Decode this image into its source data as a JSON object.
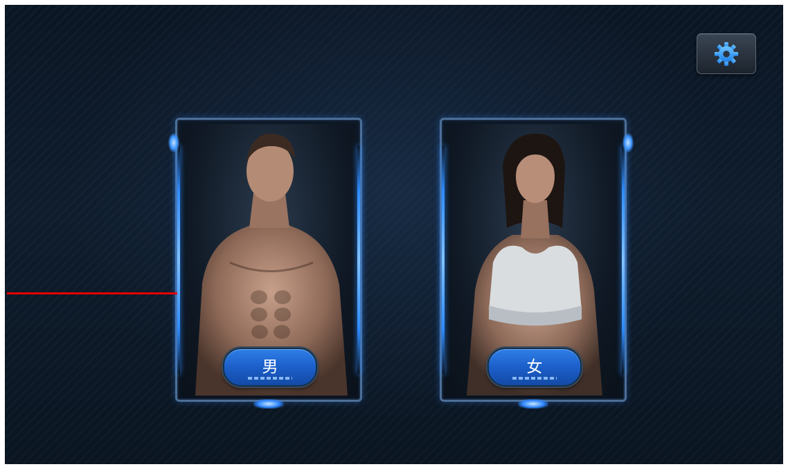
{
  "settings": {
    "icon": "gear-icon",
    "accent": "#2f9bff"
  },
  "options": [
    {
      "label": "男",
      "figure": "male-fitness-model"
    },
    {
      "label": "女",
      "figure": "female-fitness-model"
    }
  ],
  "colors": {
    "background": "#0d1a28",
    "frame": "#4d6f98",
    "button": "#1c5fc9",
    "glow": "#2f8cff",
    "guide_line": "#e60000"
  }
}
